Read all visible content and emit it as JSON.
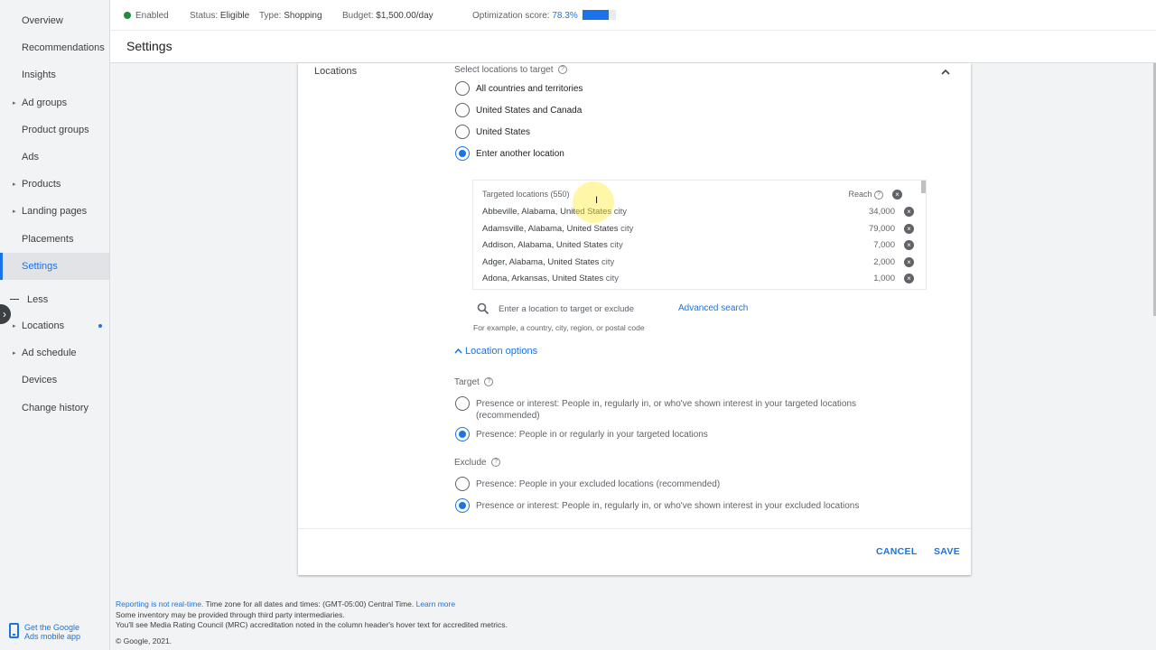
{
  "sidebar": {
    "items": [
      {
        "label": "Overview",
        "caret": false
      },
      {
        "label": "Recommendations",
        "caret": false
      },
      {
        "label": "Insights",
        "caret": false
      },
      {
        "label": "Ad groups",
        "caret": true
      },
      {
        "label": "Product groups",
        "caret": false
      },
      {
        "label": "Ads",
        "caret": false
      },
      {
        "label": "Products",
        "caret": true
      },
      {
        "label": "Landing pages",
        "caret": true
      },
      {
        "label": "Placements",
        "caret": false
      },
      {
        "label": "Settings",
        "caret": false,
        "active": true
      }
    ],
    "less_label": "Less",
    "more_items": [
      {
        "label": "Locations",
        "caret": true,
        "dot": true
      },
      {
        "label": "Ad schedule",
        "caret": true
      },
      {
        "label": "Devices",
        "caret": false
      },
      {
        "label": "Change history",
        "caret": false
      }
    ],
    "mobile_app_line1": "Get the Google",
    "mobile_app_line2": "Ads mobile app"
  },
  "header": {
    "status": "Enabled",
    "status_color": "#1e8e3e",
    "eligibility_label": "Status:",
    "eligibility_value": "Eligible",
    "type_label": "Type:",
    "type_value": "Shopping",
    "budget_label": "Budget:",
    "budget_value": "$1,500.00/day",
    "opt_label": "Optimization score:",
    "opt_value": "78.3%",
    "opt_fraction": 0.783,
    "title": "Settings"
  },
  "locations": {
    "section_label": "Locations",
    "select_label": "Select locations to target",
    "options": [
      {
        "label": "All countries and territories",
        "checked": false
      },
      {
        "label": "United States and Canada",
        "checked": false
      },
      {
        "label": "United States",
        "checked": false
      },
      {
        "label": "Enter another location",
        "checked": true
      }
    ],
    "targeted_header": "Targeted locations (550)",
    "reach_header": "Reach",
    "rows": [
      {
        "name": "Abbeville, Alabama, United States",
        "type": "city",
        "reach": "34,000"
      },
      {
        "name": "Adamsville, Alabama, United States",
        "type": "city",
        "reach": "79,000"
      },
      {
        "name": "Addison, Alabama, United States",
        "type": "city",
        "reach": "7,000"
      },
      {
        "name": "Adger, Alabama, United States",
        "type": "city",
        "reach": "2,000"
      },
      {
        "name": "Adona, Arkansas, United States",
        "type": "city",
        "reach": "1,000"
      }
    ],
    "search_placeholder": "Enter a location to target or exclude",
    "advanced_search": "Advanced search",
    "search_hint": "For example, a country, city, region, or postal code",
    "options_toggle": "Location options",
    "target_label": "Target",
    "target_options": [
      {
        "label": "Presence or interest: People in, regularly in, or who've shown interest in your targeted locations (recommended)",
        "checked": false
      },
      {
        "label": "Presence: People in or regularly in your targeted locations",
        "checked": true
      }
    ],
    "exclude_label": "Exclude",
    "exclude_options": [
      {
        "label": "Presence: People in your excluded locations (recommended)",
        "checked": false
      },
      {
        "label": "Presence or interest: People in, regularly in, or who've shown interest in your excluded locations",
        "checked": true
      }
    ],
    "cancel": "CANCEL",
    "save": "SAVE"
  },
  "footer": {
    "line1_link": "Reporting is not real-time.",
    "line1_text": " Time zone for all dates and times: (GMT-05:00) Central Time. ",
    "line1_link2": "Learn more",
    "line2": "Some inventory may be provided through third party intermediaries.",
    "line3": "You'll see Media Rating Council (MRC) accreditation noted in the column header's hover text for accredited metrics.",
    "line4": "© Google, 2021."
  },
  "colors": {
    "accent": "#1a73e8",
    "enabled": "#1e8e3e"
  },
  "icons": [
    "help-icon",
    "chevron-up-icon",
    "remove-icon",
    "search-icon",
    "phone-icon"
  ]
}
